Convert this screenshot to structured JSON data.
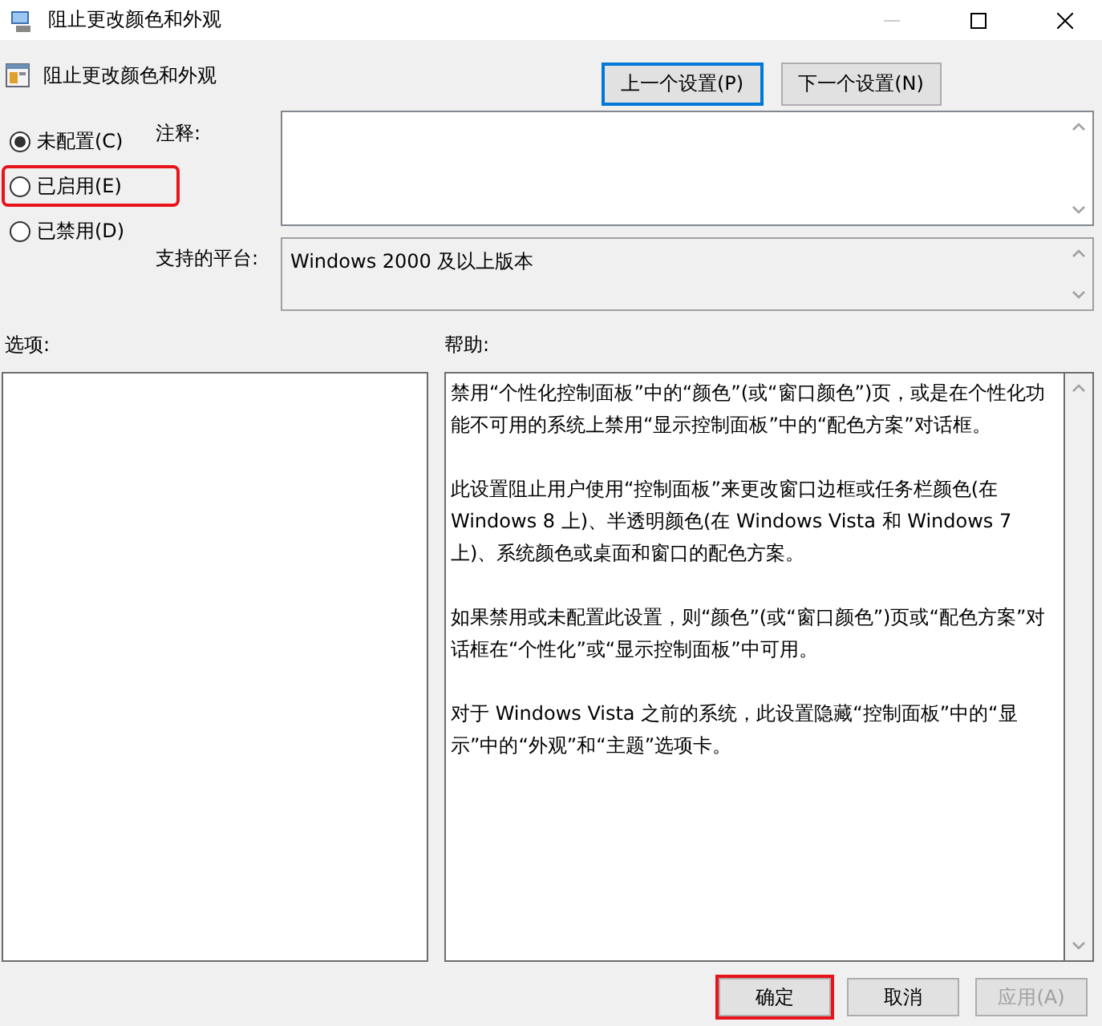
{
  "window": {
    "title": "阻止更改颜色和外观",
    "minimize_disabled": true
  },
  "header": {
    "title": "阻止更改颜色和外观"
  },
  "nav_buttons": [
    {
      "label": "上一个设置(P)",
      "focused": true
    },
    {
      "label": "下一个设置(N)",
      "focused": false
    }
  ],
  "states": [
    {
      "label": "未配置(C)",
      "selected": true,
      "highlighted": false
    },
    {
      "label": "已启用(E)",
      "selected": false,
      "highlighted": true
    },
    {
      "label": "已禁用(D)",
      "selected": false,
      "highlighted": false
    }
  ],
  "comment": {
    "label": "注释:"
  },
  "platform": {
    "label": "支持的平台:",
    "value": "Windows 2000 及以上版本"
  },
  "options": {
    "label": "选项:"
  },
  "help": {
    "label": "帮助:",
    "paragraphs": [
      "禁用“个性化控制面板”中的“颜色”(或“窗口颜色”)页，或是在个性化功能不可用的系统上禁用“显示控制面板”中的“配色方案”对话框。",
      "此设置阻止用户使用“控制面板”来更改窗口边框或任务栏颜色(在 Windows 8 上)、半透明颜色(在 Windows Vista 和 Windows 7 上)、系统颜色或桌面和窗口的配色方案。",
      "如果禁用或未配置此设置，则“颜色”(或“窗口颜色”)页或“配色方案”对话框在“个性化”或“显示控制面板”中可用。",
      "对于 Windows Vista 之前的系统，此设置隐藏“控制面板”中的“显示”中的“外观”和“主题”选项卡。"
    ]
  },
  "footer_buttons": [
    {
      "label": "确定",
      "disabled": false,
      "highlighted": true
    },
    {
      "label": "取消",
      "disabled": false,
      "highlighted": false
    },
    {
      "label": "应用(A)",
      "disabled": true,
      "highlighted": false
    }
  ]
}
